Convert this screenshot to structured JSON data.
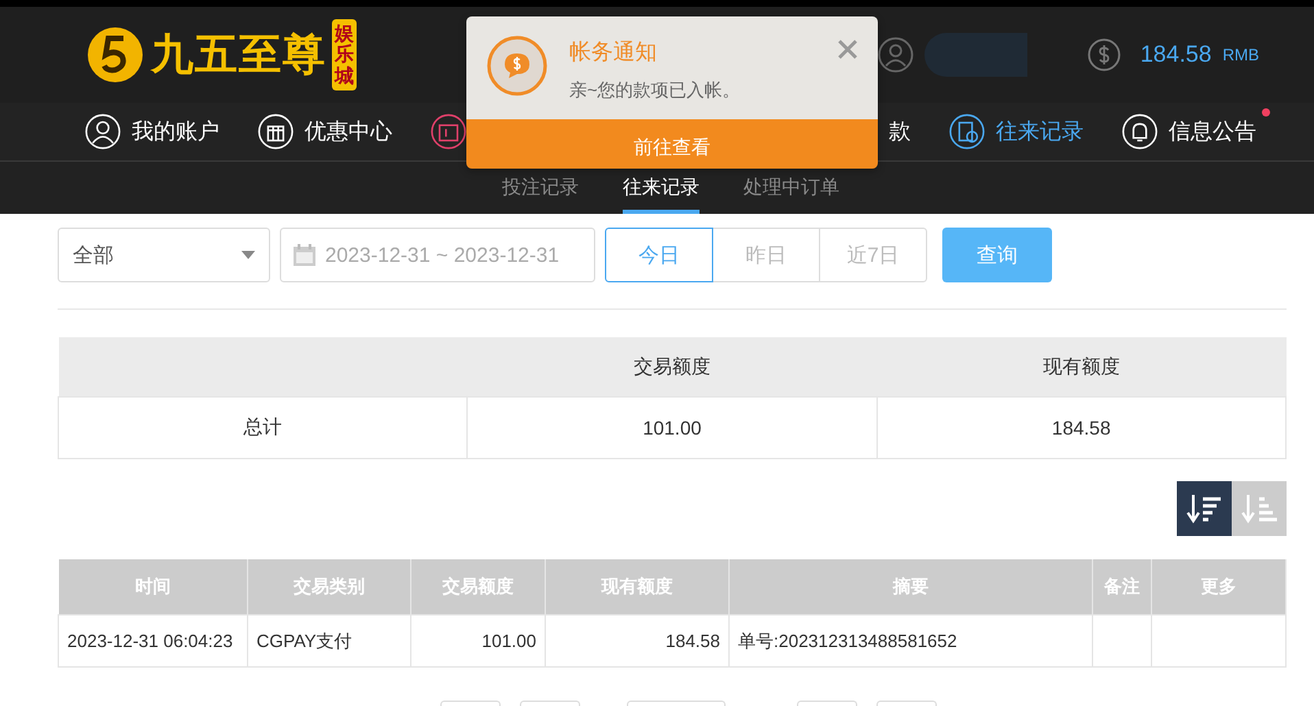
{
  "header": {
    "logo": {
      "name": "九五至尊",
      "badge": "娱乐城"
    },
    "balance": {
      "amount": "184.58",
      "unit": "RMB"
    }
  },
  "nav": [
    {
      "label": "我的账户",
      "selected": false,
      "kind": "user",
      "dot": false
    },
    {
      "label": "优惠中心",
      "selected": false,
      "kind": "gift",
      "dot": false
    },
    {
      "selected": false,
      "kind": "wallet",
      "dot": false
    },
    {
      "label": "款",
      "selected": false,
      "kind": "withdraw",
      "dot": false
    },
    {
      "label": "往来记录",
      "selected": true,
      "kind": "records",
      "dot": false
    },
    {
      "label": "信息公告",
      "selected": false,
      "kind": "bell",
      "dot": true
    }
  ],
  "subtabs": [
    {
      "label": "投注记录",
      "selected": false
    },
    {
      "label": "往来记录",
      "selected": true
    },
    {
      "label": "处理中订单",
      "selected": false
    }
  ],
  "notification": {
    "title": "帐务通知",
    "message": "亲~您的款项已入帐。",
    "action": "前往查看"
  },
  "filters": {
    "type": "全部",
    "date_range": "2023-12-31 ~ 2023-12-31",
    "quick": [
      {
        "label": "今日",
        "selected": true
      },
      {
        "label": "昨日",
        "selected": false
      },
      {
        "label": "近7日",
        "selected": false
      }
    ],
    "search": "查询"
  },
  "summary": {
    "columns": [
      "",
      "交易额度",
      "现有额度"
    ],
    "rows": [
      [
        "总计",
        "101.00",
        "184.58"
      ]
    ]
  },
  "sort": [
    {
      "selected": true
    },
    {
      "selected": false
    }
  ],
  "table": {
    "columns": [
      "时间",
      "交易类别",
      "交易额度",
      "现有额度",
      "摘要",
      "备注",
      "更多"
    ],
    "rows": [
      [
        "2023-12-31 06:04:23",
        "CGPAY支付",
        "101.00",
        "184.58",
        "单号:202312313488581652",
        "",
        ""
      ]
    ]
  }
}
